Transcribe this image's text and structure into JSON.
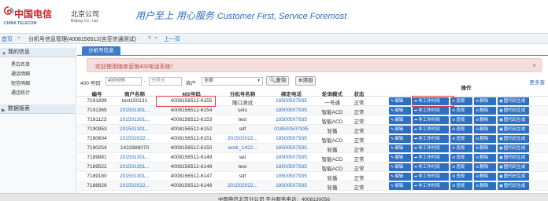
{
  "header": {
    "logo_cn": "中国电信",
    "logo_en": "CHINA TELECOM",
    "branch_cn": "北京公司",
    "branch_en": "Beijing Co., Ltd.",
    "slogan_cn": "用户至上 用心服务",
    "slogan_en": "Customer First, Service Foremost"
  },
  "breadcrumb": {
    "home": "首页",
    "current": "分机号信息管理(4008156512(吉亚信通测试)",
    "close": "×",
    "prev": "上一页"
  },
  "sidebar": {
    "sections": [
      {
        "label": "我的信息",
        "items": [
          "黑白名单",
          "通话明细",
          "短信明细",
          "通话统计"
        ]
      },
      {
        "label": "数据报表",
        "items": []
      }
    ]
  },
  "tab": {
    "label": "分机号信息"
  },
  "alert": {
    "text": "欢迎使用随幸营销400电话系统！",
    "close": "×"
  },
  "filter": {
    "label_400": "400 号码",
    "input_400": "400号码",
    "sep": "-",
    "ext_placeholder": "分机号",
    "merchant_label": "商户",
    "merchant_value": "全部",
    "search_button": "查询",
    "add_button": "添加",
    "more": "更多查"
  },
  "table": {
    "columns": [
      "编号",
      "商户名称",
      "400号码",
      "分机号名称",
      "绑定电话",
      "轮询模式",
      "状态",
      "操作"
    ],
    "op_labels": [
      "编辑",
      "非工作时间",
      "违规",
      "删除",
      "图代码生成"
    ],
    "rows": [
      [
        "7191899",
        "test150131",
        "4008156512-6155",
        "隆口测试",
        "18500507935",
        "一号通",
        "正常"
      ],
      [
        "7191365",
        "201501301...",
        "4008156512-6154",
        "sets",
        "18500507935",
        "智能ACD",
        "正常"
      ],
      [
        "7191123",
        "201501301...",
        "4008156512-6153",
        "test",
        "18500507935",
        "智能ACD",
        "正常"
      ],
      [
        "7190953",
        "201501301...",
        "4008156512-6152",
        "sdf",
        "018500507935",
        "轮循",
        "正常"
      ],
      [
        "7190604",
        "201502022...",
        "4008156512-6151",
        "201502022...",
        "18500507935",
        "智能ACD",
        "正常"
      ],
      [
        "7190254",
        "1422888070",
        "4008156512-6150",
        "work_1422...",
        "18500507935",
        "轮循",
        "正常"
      ],
      [
        "7189881",
        "201501301...",
        "4008156512-6149",
        "set",
        "18500507935",
        "智能ACD",
        "正常"
      ],
      [
        "7189522",
        "201501301...",
        "4008156512-6148",
        "test",
        "18500507935",
        "智能ACD",
        "正常"
      ],
      [
        "7189180",
        "201501301...",
        "4008156512-6147",
        "sdf",
        "18500507935",
        "轮循",
        "正常"
      ],
      [
        "7188826",
        "201502022...",
        "4008156512-6146",
        "201502022...",
        "18500507935",
        "轮循",
        "正常"
      ]
    ]
  },
  "footer": {
    "text": "中国电信北京分公司 平台服务电话：4008130056"
  },
  "colors": {
    "brand_red": "#d0262c",
    "accent_blue": "#2a6cc2",
    "button_blue": "#2e6fc0",
    "highlight": "#e53935"
  }
}
